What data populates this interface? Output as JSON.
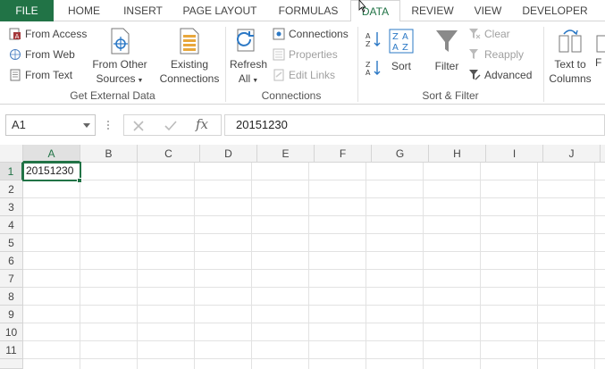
{
  "tabs": [
    {
      "label": "FILE"
    },
    {
      "label": "HOME"
    },
    {
      "label": "INSERT"
    },
    {
      "label": "PAGE LAYOUT"
    },
    {
      "label": "FORMULAS"
    },
    {
      "label": "DATA"
    },
    {
      "label": "REVIEW"
    },
    {
      "label": "VIEW"
    },
    {
      "label": "DEVELOPER"
    }
  ],
  "ribbon": {
    "get_external": {
      "from_access": "From Access",
      "from_web": "From Web",
      "from_text": "From Text",
      "from_other_1": "From Other",
      "from_other_2": "Sources",
      "existing_1": "Existing",
      "existing_2": "Connections",
      "label": "Get External Data"
    },
    "connections": {
      "refresh_1": "Refresh",
      "refresh_2": "All",
      "connections": "Connections",
      "properties": "Properties",
      "edit_links": "Edit Links",
      "label": "Connections"
    },
    "sort_filter": {
      "sort": "Sort",
      "filter": "Filter",
      "clear": "Clear",
      "reapply": "Reapply",
      "advanced": "Advanced",
      "label": "Sort & Filter"
    },
    "data_tools": {
      "text_to_1": "Text to",
      "text_to_2": "Columns",
      "partial": "F"
    }
  },
  "formula_bar": {
    "name_box": "A1",
    "fx": "fx",
    "value": "20151230"
  },
  "grid": {
    "columns": [
      "A",
      "B",
      "C",
      "D",
      "E",
      "F",
      "G",
      "H",
      "I",
      "J"
    ],
    "rows": [
      "1",
      "2",
      "3",
      "4",
      "5",
      "6",
      "7",
      "8",
      "9",
      "10",
      "11"
    ],
    "a1_value": "20151230"
  },
  "colors": {
    "accent": "#217346",
    "header_bg": "#f3f3f3",
    "gridline": "#e2e2e2",
    "disabled": "#a0a0a0"
  }
}
